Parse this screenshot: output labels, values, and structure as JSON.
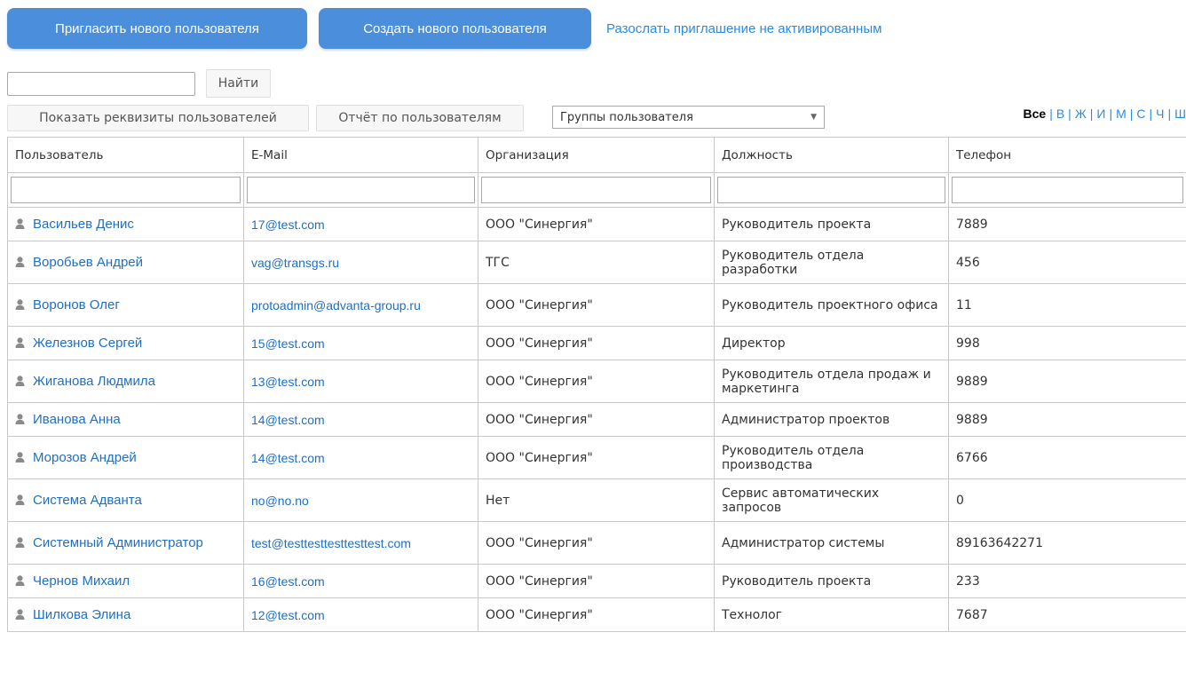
{
  "toolbar": {
    "invite_label": "Пригласить нового пользователя",
    "create_label": "Создать нового пользователя",
    "resend_label": "Разослать приглашение не активированным",
    "accent_color": "#4b8fdc"
  },
  "search": {
    "value": "",
    "find_label": "Найти"
  },
  "actions": {
    "details_label": "Показать реквизиты пользователей",
    "report_label": "Отчёт по пользователям",
    "groups_selected": "Группы пользователя"
  },
  "letters": {
    "all": "Все",
    "items": [
      "В",
      "Ж",
      "И",
      "М",
      "С",
      "Ч",
      "Ш"
    ]
  },
  "table": {
    "headers": [
      "Пользователь",
      "E-Mail",
      "Организация",
      "Должность",
      "Телефон"
    ],
    "rows": [
      {
        "name": "Васильев Денис",
        "email": "17@test.com",
        "org": "ООО \"Синергия\"",
        "position": "Руководитель проекта",
        "phone": "7889"
      },
      {
        "name": "Воробьев Андрей",
        "email": "vag@transgs.ru",
        "org": "ТГС",
        "position": "Руководитель отдела разработки",
        "phone": "456"
      },
      {
        "name": "Воронов Олег",
        "email": "protoadmin@advanta-group.ru",
        "org": "ООО \"Синергия\"",
        "position": "Руководитель проектного офиса",
        "phone": "11"
      },
      {
        "name": "Железнов Сергей",
        "email": "15@test.com",
        "org": "ООО \"Синергия\"",
        "position": "Директор",
        "phone": "998"
      },
      {
        "name": "Жиганова Людмила",
        "email": "13@test.com",
        "org": "ООО \"Синергия\"",
        "position": "Руководитель отдела продаж и маркетинга",
        "phone": "9889"
      },
      {
        "name": "Иванова Анна",
        "email": "14@test.com",
        "org": "ООО \"Синергия\"",
        "position": "Администратор проектов",
        "phone": "9889"
      },
      {
        "name": "Морозов Андрей",
        "email": "14@test.com",
        "org": "ООО \"Синергия\"",
        "position": "Руководитель отдела производства",
        "phone": "6766"
      },
      {
        "name": "Система Адванта",
        "email": "no@no.no",
        "org": "Нет",
        "position": "Сервис автоматических запросов",
        "phone": "0"
      },
      {
        "name": "Системный Администратор",
        "email": "test@testtesttesttesttest.com",
        "org": "ООО \"Синергия\"",
        "position": "Администратор системы",
        "phone": "89163642271"
      },
      {
        "name": "Чернов Михаил",
        "email": "16@test.com",
        "org": "ООО \"Синергия\"",
        "position": "Руководитель проекта",
        "phone": "233"
      },
      {
        "name": "Шилкова Элина",
        "email": "12@test.com",
        "org": "ООО \"Синергия\"",
        "position": "Технолог",
        "phone": "7687"
      }
    ]
  }
}
